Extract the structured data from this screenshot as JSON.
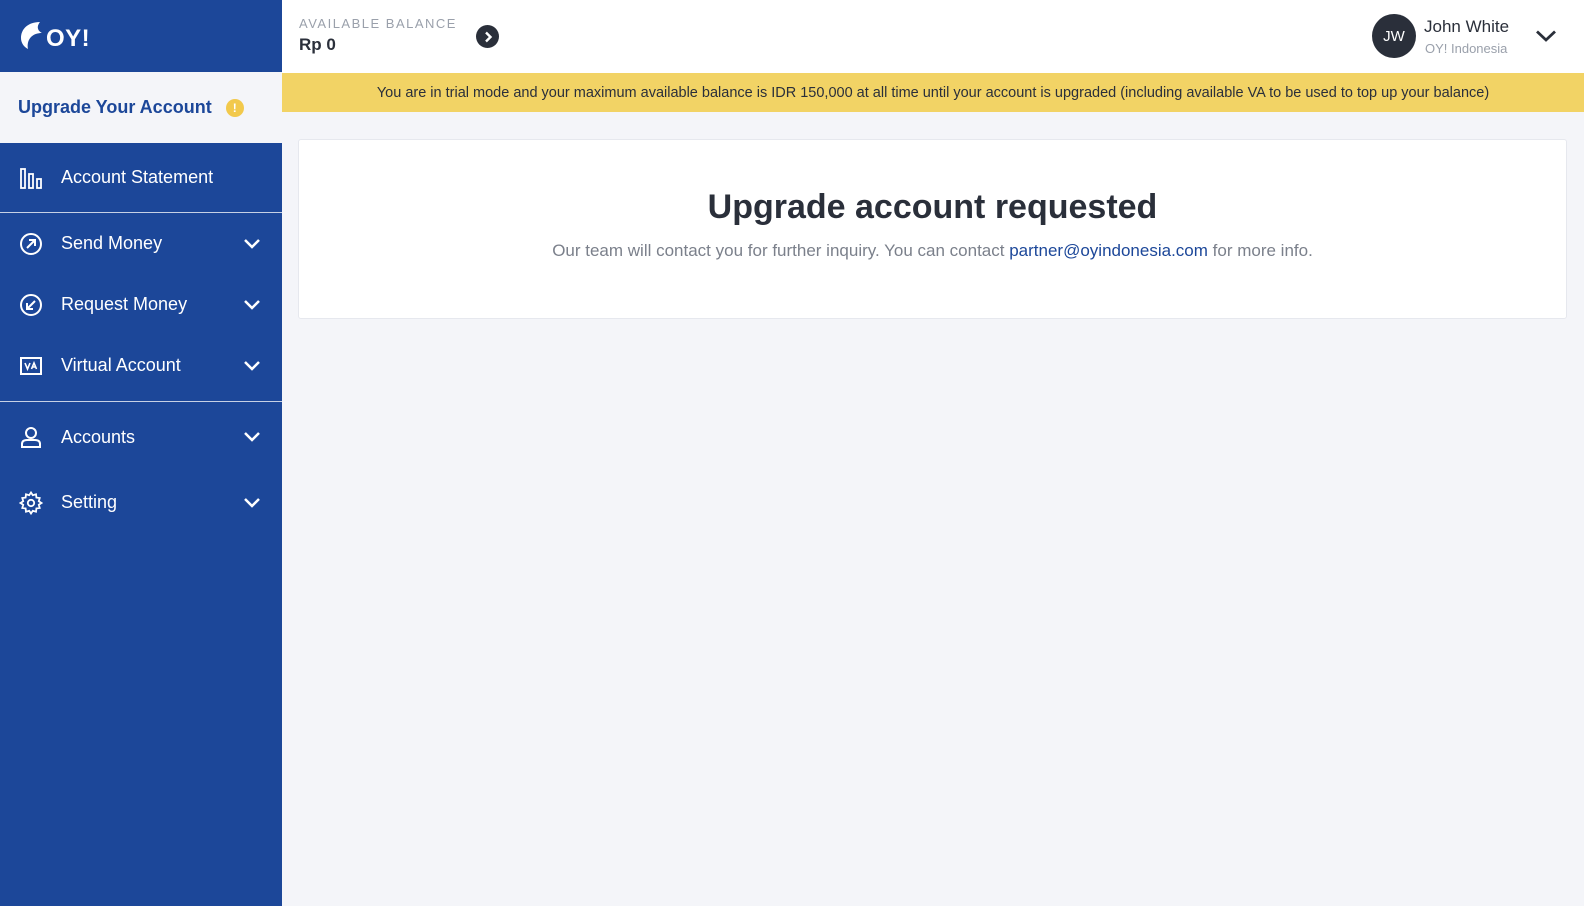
{
  "brand": {
    "logo_text": "OY!"
  },
  "sidebar": {
    "upgrade": {
      "label": "Upgrade Your Account",
      "badge": "!"
    },
    "items": [
      {
        "label": "Account Statement",
        "icon": "bar-chart-icon"
      },
      {
        "label": "Send Money",
        "icon": "arrow-up-right-circle-icon"
      },
      {
        "label": "Request Money",
        "icon": "arrow-down-left-circle-icon"
      },
      {
        "label": "Virtual Account",
        "icon": "va-card-icon"
      },
      {
        "label": "Accounts",
        "icon": "user-icon"
      },
      {
        "label": "Setting",
        "icon": "gear-icon"
      }
    ]
  },
  "header": {
    "balance_label": "AVAILABLE BALANCE",
    "balance_value": "Rp 0",
    "user": {
      "initials": "JW",
      "name": "John White",
      "org": "OY! Indonesia"
    }
  },
  "banner": {
    "text": "You are in trial mode and your maximum available balance is IDR 150,000 at all time until your account is upgraded (including available VA to be used to top up your balance)"
  },
  "card": {
    "title": "Upgrade account requested",
    "text_before": "Our team will contact you for further inquiry. You can contact ",
    "email": "partner@oyindonesia.com",
    "text_after": " for more info."
  },
  "colors": {
    "sidebar": "#1c4799",
    "banner": "#f2d365",
    "accent": "#1c4799",
    "badge": "#f2c94c",
    "text": "#2a2f3a"
  }
}
